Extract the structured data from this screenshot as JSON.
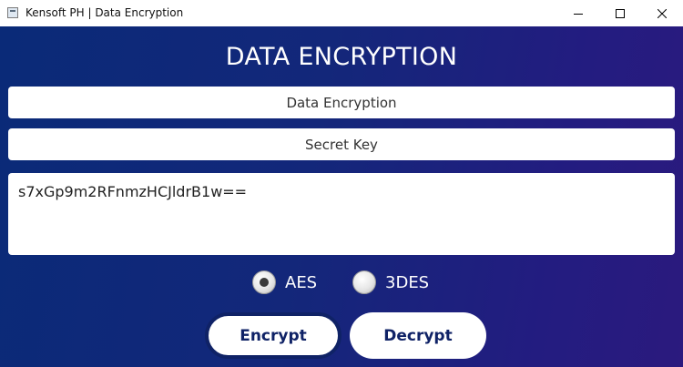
{
  "window": {
    "title": "Kensoft PH | Data Encryption",
    "controls": [
      "minimize-icon",
      "maximize-icon",
      "close-icon"
    ]
  },
  "main": {
    "heading": "DATA ENCRYPTION",
    "data_field_placeholder": "Data Encryption",
    "key_field_placeholder": "Secret Key",
    "output_text": "s7xGp9m2RFnmzHCJldrB1w=="
  },
  "algorithm": {
    "options": [
      {
        "label": "AES",
        "selected": true
      },
      {
        "label": "3DES",
        "selected": false
      }
    ]
  },
  "actions": {
    "encrypt_label": "Encrypt",
    "decrypt_label": "Decrypt"
  },
  "colors": {
    "background_start": "#0a2a78",
    "background_end": "#2b1a7e",
    "button_text": "#0f2266",
    "heading_text": "#ffffff"
  }
}
